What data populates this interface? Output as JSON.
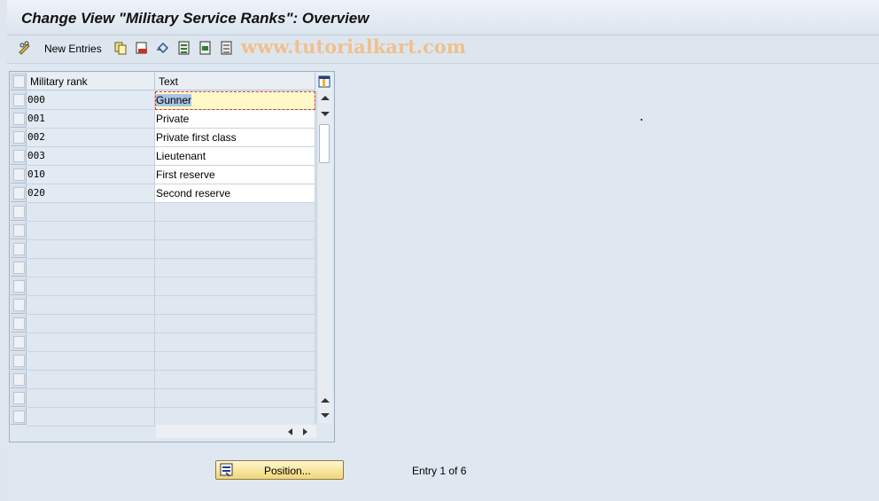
{
  "title": "Change View \"Military Service Ranks\": Overview",
  "toolbar": {
    "new_entries_label": "New Entries",
    "icons": [
      "pencil-glasses-icon",
      "copy-icon",
      "delete-icon",
      "undo-icon",
      "select-all-icon",
      "select-block-icon",
      "deselect-all-icon"
    ]
  },
  "watermark": "www.tutorialkart.com",
  "table": {
    "columns": [
      "Military rank",
      "Text"
    ],
    "rows": [
      {
        "rank": "000",
        "text": "Gunner"
      },
      {
        "rank": "001",
        "text": "Private"
      },
      {
        "rank": "002",
        "text": "Private first class"
      },
      {
        "rank": "003",
        "text": "Lieutenant"
      },
      {
        "rank": "010",
        "text": "First reserve"
      },
      {
        "rank": "020",
        "text": "Second reserve"
      }
    ]
  },
  "footer": {
    "position_label": "Position...",
    "entry_status": "Entry 1 of 6"
  },
  "colors": {
    "background": "#dfe6ef",
    "button": "#f1d777",
    "watermark": "#f0c08e"
  }
}
